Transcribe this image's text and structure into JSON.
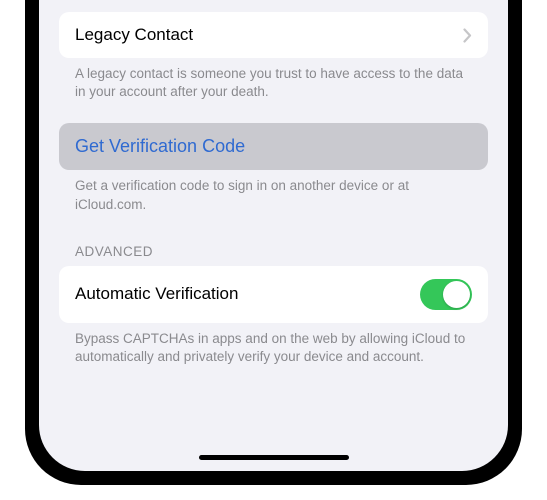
{
  "legacy_contact": {
    "label": "Legacy Contact",
    "footer": "A legacy contact is someone you trust to have access to the data in your account after your death."
  },
  "get_code": {
    "label": "Get Verification Code",
    "footer": "Get a verification code to sign in on another device or at iCloud.com."
  },
  "advanced": {
    "header": "ADVANCED",
    "auto_verification": {
      "label": "Automatic Verification",
      "enabled": true,
      "footer": "Bypass CAPTCHAs in apps and on the web by allowing iCloud to automatically and privately verify your device and account."
    }
  }
}
